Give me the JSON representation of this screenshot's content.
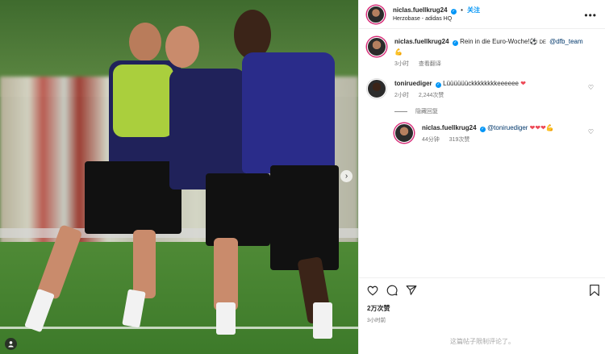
{
  "post": {
    "username": "niclas.fuellkrug24",
    "follow_label": "关注",
    "location": "Herzobase - adidas HQ",
    "more_label": "•••"
  },
  "caption": {
    "username": "niclas.fuellkrug24",
    "text_part1": "Rein in die Euro-Woche!",
    "text_part2": "DE",
    "mention": "@dfb_team",
    "time": "3小时",
    "translate_label": "查看翻译"
  },
  "comments": [
    {
      "username": "toniruediger",
      "text": "Lüüüüüückkkkkkkkeeeeee",
      "time": "2小时",
      "likes": "2,244次赞"
    }
  ],
  "hide_replies_label": "隐藏回复",
  "reply": {
    "username": "niclas.fuellkrug24",
    "mention": "@toniruediger",
    "time": "44分钟",
    "likes": "319次赞"
  },
  "actions": {
    "likes_count": "2万次赞",
    "post_time": "3小时前",
    "comments_limited": "这篇帖子限制评论了。"
  },
  "media": {
    "next_label": "›",
    "tag_label": "👤"
  },
  "colors": {
    "accent": "#0095f6",
    "heart": "#ed4956",
    "muted": "#737373"
  }
}
